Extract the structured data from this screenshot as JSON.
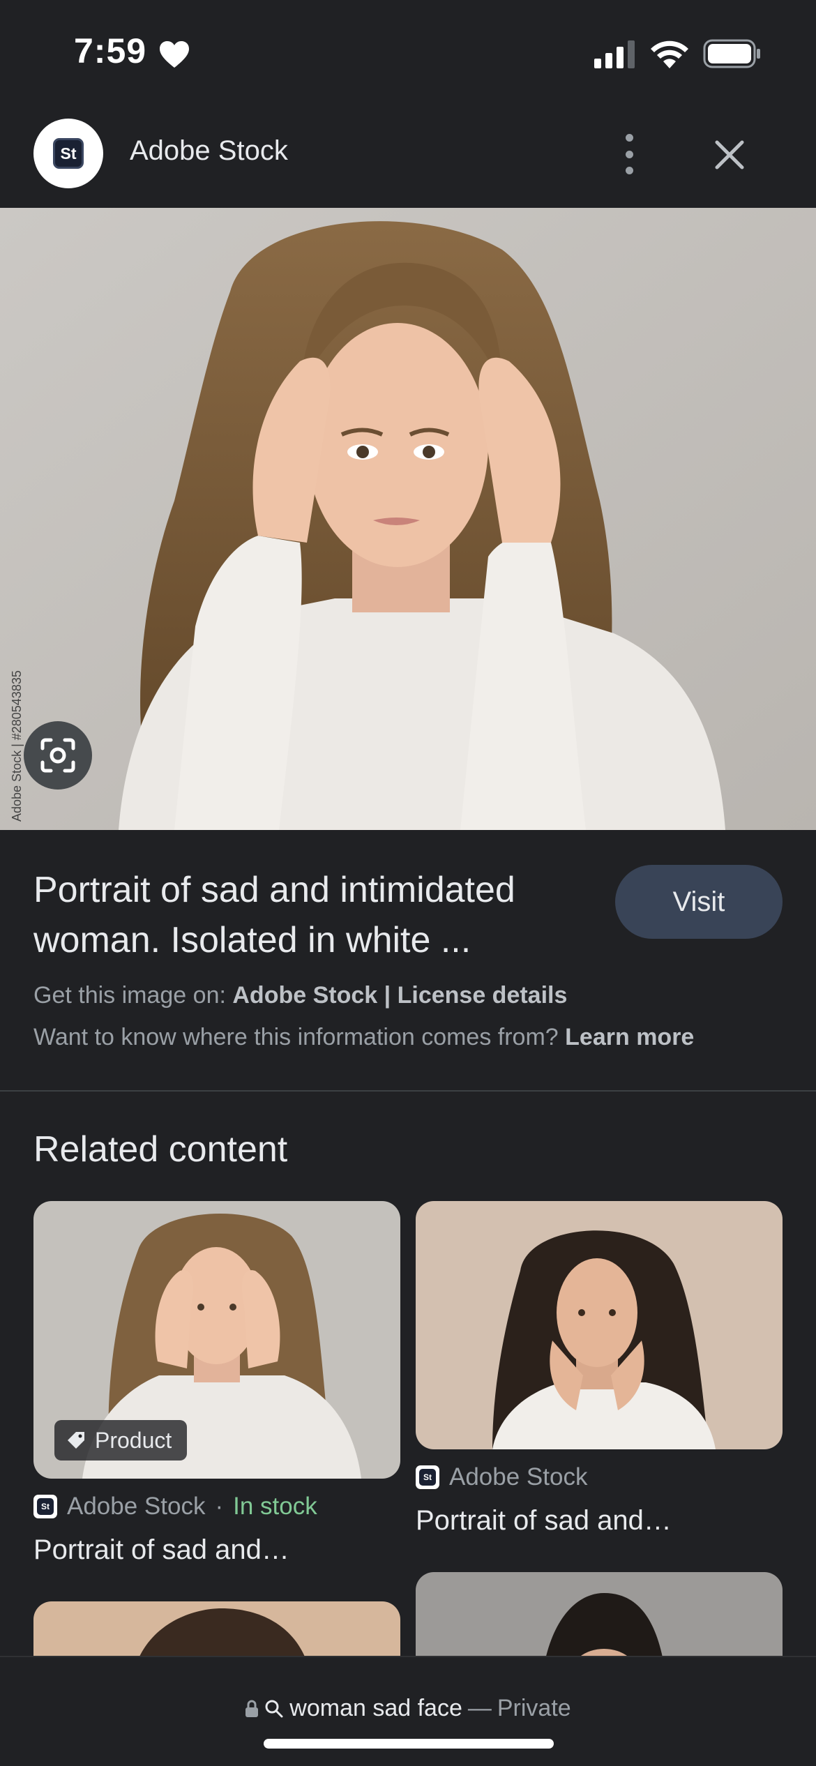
{
  "status_bar": {
    "time": "7:59"
  },
  "header": {
    "site_logo_text": "St",
    "site_name": "Adobe Stock"
  },
  "main_image": {
    "description": "Woman in white ribbed sweater holding her head with both hands",
    "side_watermark": "Adobe Stock | #280543835",
    "watermark": "Adobe Stock"
  },
  "result": {
    "title": "Portrait of sad and intimidated woman. Isolated in white ...",
    "visit_label": "Visit",
    "source_prefix": "Get this image on:",
    "source_name": "Adobe Stock",
    "separator": "|",
    "license_label": "License details",
    "info_question": "Want to know where this information comes from?",
    "learn_more_label": "Learn more"
  },
  "related": {
    "heading": "Related content",
    "cards": [
      {
        "badge": "Product",
        "source": "Adobe Stock",
        "stock_sep": "·",
        "stock": "In stock",
        "title": "Portrait of sad and…"
      },
      {
        "source": "Adobe Stock",
        "title": "Portrait of sad and…"
      }
    ]
  },
  "bottom_bar": {
    "query": "woman sad face",
    "separator": "—",
    "mode": "Private"
  },
  "colors": {
    "background": "#202124",
    "visit_button": "#394457",
    "in_stock": "#81c995"
  }
}
